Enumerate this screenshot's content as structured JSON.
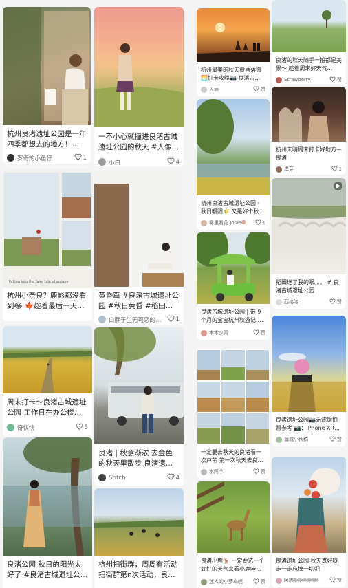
{
  "colors": {
    "accent": "#ff2442",
    "bg": "#f4f4f4"
  },
  "icons": {
    "like": "heart-icon",
    "play": "play-icon"
  },
  "left_feed": [
    {
      "title": "杭州良渚遗址公园是一年四季都想去的地方！ 杭…",
      "author": "罗奇的小鱼仔",
      "likes": "1"
    },
    {
      "title": "一不小心就撞进良渚古城遗址公园的秋天 #人像…",
      "author": "小白",
      "likes": "4"
    },
    {
      "title": "杭州小奈良？鹿影都没看到😂 🍁趁着最后一天…",
      "author": "",
      "likes": "",
      "image_caption": "Falling into the fairy tale of autumn"
    },
    {
      "title": "黄昏篇 #秋日黄昏 #稻田风…",
      "title_full": "黄昏篇 #良渚古城遗址公园 #秋日黄昏 #稻田风…",
      "author": "白胖子生无可恋的…",
      "likes": "1"
    },
    {
      "title": "周末打卡～良渚古城遗址公园 工作日在办公楼间…",
      "author": "奇快快",
      "likes": "5"
    },
    {
      "title": "良渚 | 秋意渐浓 去金色的秋天里散步 良渚遗址公…",
      "author": "Stitch",
      "likes": "4"
    },
    {
      "title": "良渚公园 秋日的阳光太好了 #良渚古城遗址公园…",
      "author": "",
      "likes": ""
    },
    {
      "title": "杭州扫街群，周周有活动扫街群第n次活动，良…",
      "author": "",
      "likes": ""
    }
  ],
  "right_feed": [
    {
      "title": "杭州最美的秋天黄昏落霞🌅打卡攻略📷 良渚古…",
      "author": "天丽",
      "likes": "赞"
    },
    {
      "title": "良渚的秋天随手一拍都是美景～ 趁着周末好天气…",
      "author": "Strawberry",
      "likes": "赞"
    },
    {
      "title": "杭州良渚古城遗址公园 · 秋日暖阳🌾 又是好个秋…",
      "author": "雾里看花 Josie🍭",
      "likes": "1"
    },
    {
      "title": "杭州天晴周末打卡好地方—良渚",
      "author": "岸芽",
      "likes": "1"
    },
    {
      "title": "稻田迷了我的眼。。。 # 良渚古城遗址公园",
      "author": "西格洛",
      "likes": "赞"
    },
    {
      "title": "良渚古城遗址公园 | 带 9 个月的宝宝杭州秋游记 被小…",
      "author": "木木夕青",
      "likes": "赞"
    },
    {
      "title": "良渚遗址公园📷无滤镜拍照参考 📷：iPhone XR…",
      "author": "僵城小秋稿",
      "likes": "赞"
    },
    {
      "title": "一定要去秋天的良渚看一次芦苇 第一次秋天去良…",
      "author": "水阿芊",
      "likes": "赞"
    },
    {
      "title": "良渚小鹿🦌 一定要选一个好好的天气来看小鹿哇…",
      "author": "迷人的小萝鸟呢",
      "likes": "赞"
    },
    {
      "title": "良渚遗址公园 秋天真好呀 走一走忘掉一切吧",
      "author": "阿嘟啊啊啊啊啊",
      "likes": "赞"
    }
  ]
}
